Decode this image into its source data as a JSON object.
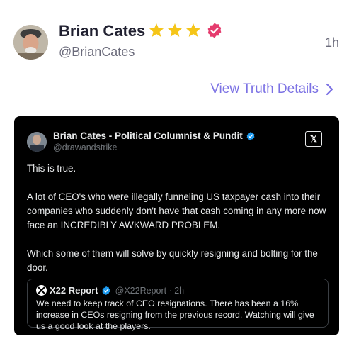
{
  "post": {
    "display_name": "Brian Cates",
    "handle": "@BrianCates",
    "time": "1h",
    "badges": [
      "star-icon",
      "star-icon",
      "star-icon",
      "verified-badge-icon"
    ],
    "details_link": "View Truth Details"
  },
  "embed": {
    "author_name": "Brian Cates - Political Columnist & Pundit",
    "author_handle": "@drawandstrike",
    "x_logo": "𝕏",
    "paragraphs": [
      "This is true.",
      "A lot of CEO's who were illegally funneling US taxpayer cash into their companies who suddenly don't have that cash coming in any more now face an INCREDIBLY AWKWARD PROBLEM.",
      "Which some of them will solve by quickly resigning and bolting for the door."
    ],
    "quote": {
      "author_name": "X22 Report",
      "author_handle": "@X22Report · 2h",
      "text": "We need to keep track of CEO resignations. There has been a 16% increase in CEOs resigning from the previous record. Watching will give us a good look at the players."
    }
  },
  "colors": {
    "accent": "#7c72e4",
    "star": "#f5c518",
    "verified": "#e53c6e",
    "embed_bg": "#000000"
  }
}
